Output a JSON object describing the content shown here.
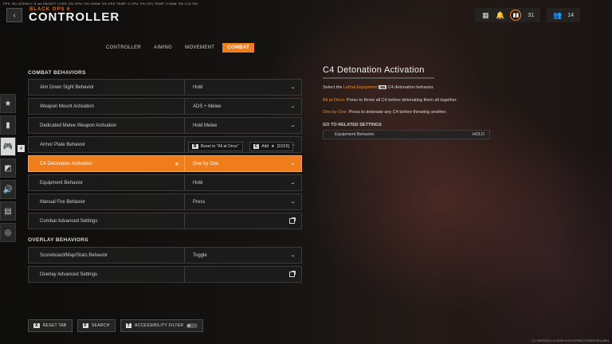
{
  "stats_bar": "FPS: 96  LATENCY: 8 ms  PACKET LOSS: 0%  GPU: 0%  VRAM: 0%  GPU TEMP: 0  CPU: 0%  CPU TEMP: 0  RAM: 0%  3:31 PM",
  "header": {
    "back_icon": "chevron-left-icon",
    "brand": "BLACK OPS 6",
    "title": "CONTROLLER"
  },
  "top_right": {
    "grid_icon": "grid-icon",
    "bell_icon": "bell-icon",
    "currency_icon": "coin-icon",
    "currency_count": "31",
    "friends_icon": "friends-icon",
    "friends_count": "14"
  },
  "tabs": [
    {
      "label": "CONTROLLER"
    },
    {
      "label": "AIMING"
    },
    {
      "label": "MOVEMENT"
    },
    {
      "label": "COMBAT"
    }
  ],
  "rail": [
    {
      "icon": "star-icon",
      "glyph": "★"
    },
    {
      "icon": "grenade-icon",
      "glyph": "▮"
    },
    {
      "icon": "controller-icon",
      "glyph": "🎮"
    },
    {
      "icon": "display-icon",
      "glyph": "◩"
    },
    {
      "icon": "audio-icon",
      "glyph": "🔊"
    },
    {
      "icon": "interface-icon",
      "glyph": "▤"
    },
    {
      "icon": "network-icon",
      "glyph": "◎"
    }
  ],
  "rail_marker": "4",
  "combat": {
    "heading": "COMBAT BEHAVIORS",
    "rows": [
      {
        "label": "Aim Down Sight Behavior",
        "value": "Hold"
      },
      {
        "label": "Weapon Mount Activation",
        "value": "ADS + Melee"
      },
      {
        "label": "Dedicated Melee Weapon Activation",
        "value": "Hold Melee"
      },
      {
        "label": "Armor Plate Behavior",
        "value": ""
      },
      {
        "label": "C4 Detonation Activation",
        "value": "One by One"
      },
      {
        "label": "Equipment Behavior",
        "value": "Hold"
      },
      {
        "label": "Manual Fire Behavior",
        "value": "Press"
      },
      {
        "label": "Combat Advanced Settings",
        "value": ""
      }
    ]
  },
  "overlay": {
    "heading": "OVERLAY BEHAVIORS",
    "rows": [
      {
        "label": "Scoreboard/Map/Stats Behavior",
        "value": "Toggle"
      },
      {
        "label": "Overlay Advanced Settings",
        "value": ""
      }
    ]
  },
  "tooltip": {
    "reset_key": "B",
    "reset_label": "Reset to \"All at Once\"",
    "add_key": "C",
    "add_label": "Add",
    "add_count": "[10/15]"
  },
  "detail": {
    "title": "C4 Detonation Activation",
    "desc_pre": "Select the",
    "desc_link": "Lethal Equipment",
    "desc_key": "RB",
    "desc_post": "C4 detonation behavior.",
    "opt1_name": "All at Once:",
    "opt1_text": "Press to throw all C4 before detonating them all together.",
    "opt2_name": "One by One:",
    "opt2_text": "Press to detonate any C4 before throwing another.",
    "related_heading": "GO TO RELATED SETTINGS",
    "related_label": "Equipment Behavior",
    "related_value": "HOLD"
  },
  "bottom": {
    "reset_key": "X",
    "reset_label": "RESET TAB",
    "search_key": "F",
    "search_label": "SEARCH",
    "access_key": "T",
    "access_label": "ACCESSIBILITY FILTER"
  },
  "build": "[1.2.2842028] [7-6.10235+11A] Th[7389] [1739804T3Ex] [Win]"
}
